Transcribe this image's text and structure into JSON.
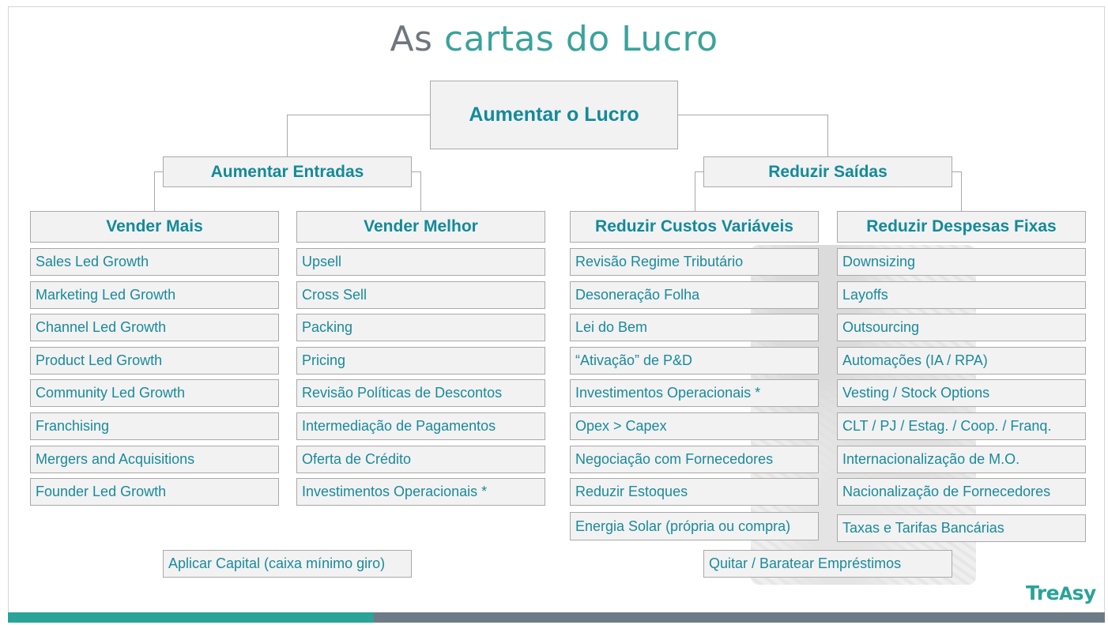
{
  "title": {
    "part1": "As",
    "part2": "cartas do Lucro"
  },
  "root": "Aumentar o Lucro",
  "left_branch": {
    "label": "Aumentar Entradas",
    "columns": [
      {
        "header": "Vender Mais",
        "items": [
          "Sales Led Growth",
          "Marketing Led Growth",
          "Channel Led Growth",
          "Product Led Growth",
          "Community Led Growth",
          "Franchising",
          "Mergers and Acquisitions",
          "Founder Led Growth"
        ]
      },
      {
        "header": "Vender Melhor",
        "items": [
          "Upsell",
          "Cross Sell",
          "Packing",
          "Pricing",
          "Revisão Políticas de Descontos",
          "Intermediação de Pagamentos",
          "Oferta de Crédito",
          "Investimentos Operacionais *"
        ]
      }
    ],
    "footer": "Aplicar Capital (caixa mínimo giro)"
  },
  "right_branch": {
    "label": "Reduzir Saídas",
    "columns": [
      {
        "header": "Reduzir Custos Variáveis",
        "items": [
          "Revisão Regime Tributário",
          "Desoneração Folha",
          "Lei do Bem",
          "“Ativação” de P&D",
          "Investimentos Operacionais *",
          "Opex > Capex",
          "Negociação com Fornecedores",
          "Reduzir Estoques",
          "Energia Solar (própria ou compra)"
        ]
      },
      {
        "header": "Reduzir Despesas Fixas",
        "items": [
          "Downsizing",
          "Layoffs",
          "Outsourcing",
          "Automações (IA / RPA)",
          "Vesting / Stock Options",
          "CLT / PJ / Estag. / Coop. / Franq.",
          "Internacionalização de M.O.",
          "Nacionalização de Fornecedores",
          "Taxas e Tarifas Bancárias"
        ]
      }
    ],
    "footer": "Quitar / Baratear Empréstimos"
  },
  "logo": {
    "text_pre": "Tre",
    "text_a": "A",
    "text_post": "sy"
  },
  "colors": {
    "teal": "#1a8a9c",
    "title_grey": "#6f7680",
    "title_teal": "#3aa39a",
    "bar_left": "#2aa398",
    "bar_right": "#6e7b87"
  }
}
